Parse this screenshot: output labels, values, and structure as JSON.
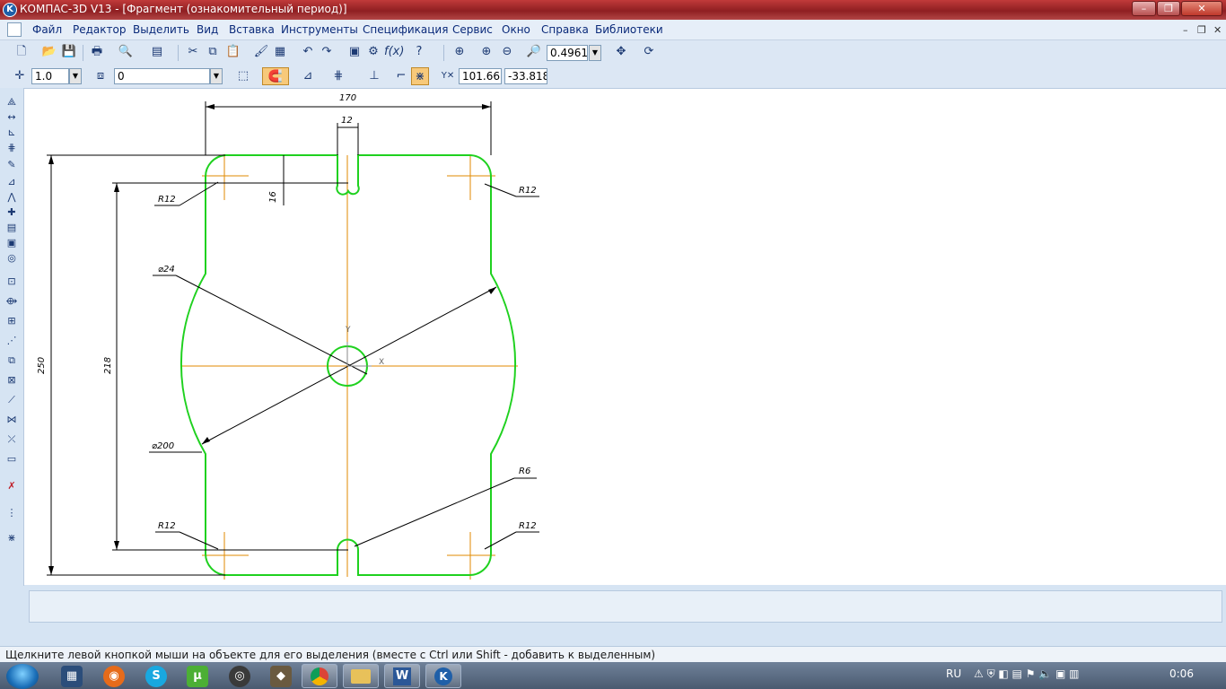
{
  "window": {
    "title": "КОМПАС-3D V13 - [Фрагмент (ознакомительный период)]",
    "app_icon": "K",
    "controls": {
      "minimize": "–",
      "maximize": "❐",
      "close": "✕"
    }
  },
  "menu": {
    "items": [
      "Файл",
      "Редактор",
      "Выделить",
      "Вид",
      "Вставка",
      "Инструменты",
      "Спецификация",
      "Сервис",
      "Окно",
      "Справка",
      "Библиотеки"
    ],
    "mdi_controls": {
      "minimize": "–",
      "restore": "❐",
      "close": "✕"
    }
  },
  "toolbar_main": {
    "zoom_value": "0.4961"
  },
  "toolbar_current": {
    "step_value": "1.0",
    "layer_value": "0",
    "coord_x": "101.66(",
    "coord_y": "-33.818"
  },
  "drawing": {
    "dimensions": {
      "top_width": "170",
      "slot_width": "12",
      "slot_depth": "16",
      "total_height": "250",
      "inner_height": "218",
      "radius_top_left": "R12",
      "radius_top_right": "R12",
      "radius_bottom_left": "R12",
      "radius_bottom_right": "R12",
      "radius_slot_bottom": "R6",
      "hole_diameter": "⌀24",
      "arc_diameter": "⌀200"
    },
    "axis_labels": {
      "x": "X",
      "y": "Y"
    },
    "colors": {
      "contour": "#1fd11f",
      "axis": "#e08a00",
      "dimension": "#000000"
    }
  },
  "status_bar": {
    "text": "Щелкните левой кнопкой мыши на объекте для его выделения (вместе с Ctrl или Shift - добавить к выделенным)"
  },
  "taskbar": {
    "tray_language": "RU",
    "clock": "0:06"
  }
}
